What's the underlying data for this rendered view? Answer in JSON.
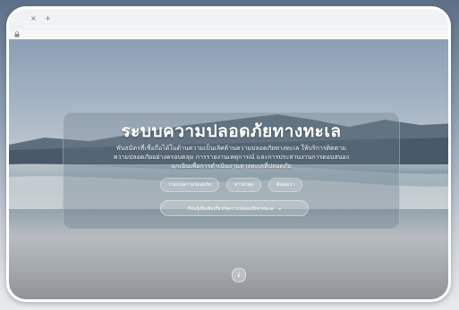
{
  "browser": {
    "close_tab_glyph": "×",
    "new_tab_glyph": "+",
    "address_icon": "lock-icon"
  },
  "hero": {
    "title": "ระบบความปลอดภัยทางทะเล",
    "description_line1": "พันธมิตรที่เชื่อถือได้ในด้านความเป็นเลิศด้านความปลอดภัยทางทะเล ให้บริการติดตาม",
    "description_line2": "ความปลอดภัยอย่างครอบคลุม การรายงานเหตุการณ์ และการประสานงานการตอบสนอง",
    "description_line3": "ฉุกเฉินเพื่อการดำเนินงานทางทะเลที่ปลอดภัย",
    "actions": [
      {
        "label": "รายงานความปลอดภัย"
      },
      {
        "label": "ข่าวล่าสุด"
      },
      {
        "label": "ติดต่อเรา"
      }
    ],
    "dropdown_label": "เรียนรู้เพิ่มเติมเกี่ยวกับความปลอดภัยทางทะเล",
    "dropdown_icon": "chevron-down-icon",
    "scroll_icon": "arrow-down-icon",
    "scroll_glyph": "↓"
  },
  "colors": {
    "panel": "#6e7d8c",
    "title": "#ffffff",
    "sky": "#8b9fb4",
    "sea": "#6f8e9a",
    "sand": "#a5a9ad"
  }
}
